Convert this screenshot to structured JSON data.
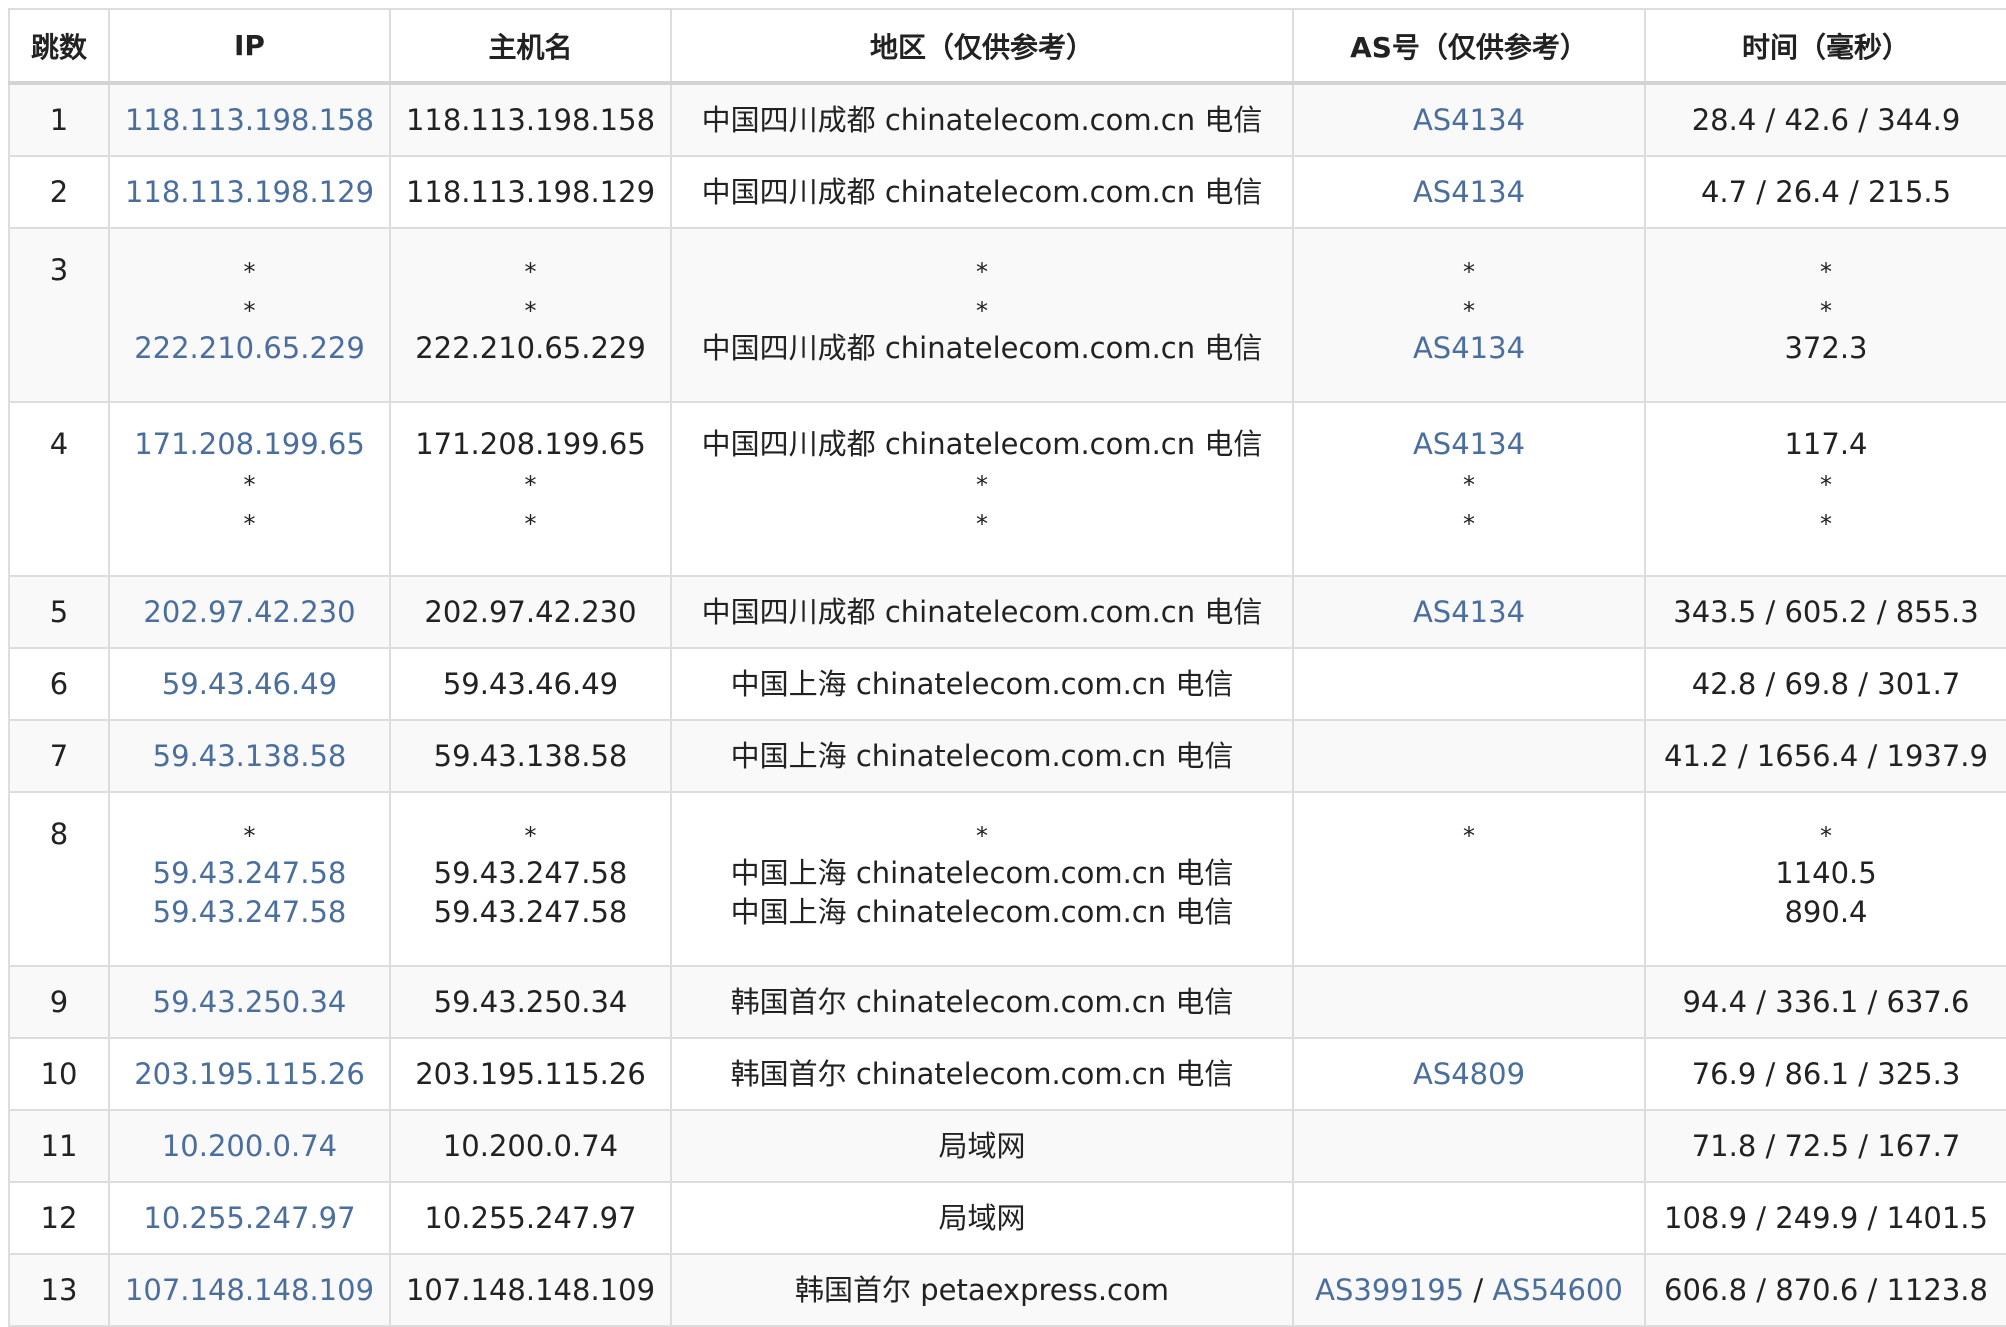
{
  "headers": {
    "hop": "跳数",
    "ip": "IP",
    "host": "主机名",
    "region": "地区（仅供参考）",
    "as": "AS号（仅供参考）",
    "time": "时间（毫秒）"
  },
  "rows": [
    {
      "hop": "1",
      "lines": [
        {
          "ip": "118.113.198.158",
          "host": "118.113.198.158",
          "region": "中国四川成都 chinatelecom.com.cn 电信",
          "as": [
            "AS4134"
          ],
          "time": "28.4 / 42.6 / 344.9"
        }
      ]
    },
    {
      "hop": "2",
      "lines": [
        {
          "ip": "118.113.198.129",
          "host": "118.113.198.129",
          "region": "中国四川成都 chinatelecom.com.cn 电信",
          "as": [
            "AS4134"
          ],
          "time": "4.7 / 26.4 / 215.5"
        }
      ]
    },
    {
      "hop": "3",
      "lines": [
        {
          "ip": "*",
          "host": "*",
          "region": "*",
          "as": [
            "*"
          ],
          "time": "*"
        },
        {
          "ip": "*",
          "host": "*",
          "region": "*",
          "as": [
            "*"
          ],
          "time": "*"
        },
        {
          "ip": "222.210.65.229",
          "host": "222.210.65.229",
          "region": "中国四川成都 chinatelecom.com.cn 电信",
          "as": [
            "AS4134"
          ],
          "time": "372.3"
        }
      ]
    },
    {
      "hop": "4",
      "lines": [
        {
          "ip": "171.208.199.65",
          "host": "171.208.199.65",
          "region": "中国四川成都 chinatelecom.com.cn 电信",
          "as": [
            "AS4134"
          ],
          "time": "117.4"
        },
        {
          "ip": "*",
          "host": "*",
          "region": "*",
          "as": [
            "*"
          ],
          "time": "*"
        },
        {
          "ip": "*",
          "host": "*",
          "region": "*",
          "as": [
            "*"
          ],
          "time": "*"
        }
      ]
    },
    {
      "hop": "5",
      "lines": [
        {
          "ip": "202.97.42.230",
          "host": "202.97.42.230",
          "region": "中国四川成都 chinatelecom.com.cn 电信",
          "as": [
            "AS4134"
          ],
          "time": "343.5 / 605.2 / 855.3"
        }
      ]
    },
    {
      "hop": "6",
      "lines": [
        {
          "ip": "59.43.46.49",
          "host": "59.43.46.49",
          "region": "中国上海 chinatelecom.com.cn 电信",
          "as": [],
          "time": "42.8 / 69.8 / 301.7"
        }
      ]
    },
    {
      "hop": "7",
      "lines": [
        {
          "ip": "59.43.138.58",
          "host": "59.43.138.58",
          "region": "中国上海 chinatelecom.com.cn 电信",
          "as": [],
          "time": "41.2 / 1656.4 / 1937.9"
        }
      ]
    },
    {
      "hop": "8",
      "lines": [
        {
          "ip": "*",
          "host": "*",
          "region": "*",
          "as": [
            "*"
          ],
          "time": "*"
        },
        {
          "ip": "59.43.247.58",
          "host": "59.43.247.58",
          "region": "中国上海 chinatelecom.com.cn 电信",
          "as": [],
          "time": "1140.5"
        },
        {
          "ip": "59.43.247.58",
          "host": "59.43.247.58",
          "region": "中国上海 chinatelecom.com.cn 电信",
          "as": [],
          "time": "890.4"
        }
      ]
    },
    {
      "hop": "9",
      "lines": [
        {
          "ip": "59.43.250.34",
          "host": "59.43.250.34",
          "region": "韩国首尔 chinatelecom.com.cn 电信",
          "as": [],
          "time": "94.4 / 336.1 / 637.6"
        }
      ]
    },
    {
      "hop": "10",
      "lines": [
        {
          "ip": "203.195.115.26",
          "host": "203.195.115.26",
          "region": "韩国首尔 chinatelecom.com.cn 电信",
          "as": [
            "AS4809"
          ],
          "time": "76.9 / 86.1 / 325.3"
        }
      ]
    },
    {
      "hop": "11",
      "lines": [
        {
          "ip": "10.200.0.74",
          "host": "10.200.0.74",
          "region": "局域网",
          "as": [],
          "time": "71.8 / 72.5 / 167.7"
        }
      ]
    },
    {
      "hop": "12",
      "lines": [
        {
          "ip": "10.255.247.97",
          "host": "10.255.247.97",
          "region": "局域网",
          "as": [],
          "time": "108.9 / 249.9 / 1401.5"
        }
      ]
    },
    {
      "hop": "13",
      "lines": [
        {
          "ip": "107.148.148.109",
          "host": "107.148.148.109",
          "region": "韩国首尔 petaexpress.com",
          "as": [
            "AS399195",
            "AS54600"
          ],
          "time": "606.8 / 870.6 / 1123.8"
        }
      ]
    }
  ],
  "as_separator": " / ",
  "colors": {
    "link": "#4a6e9e",
    "text": "#222222",
    "border": "#dddddd",
    "row_alt": "#f9f9f9"
  }
}
